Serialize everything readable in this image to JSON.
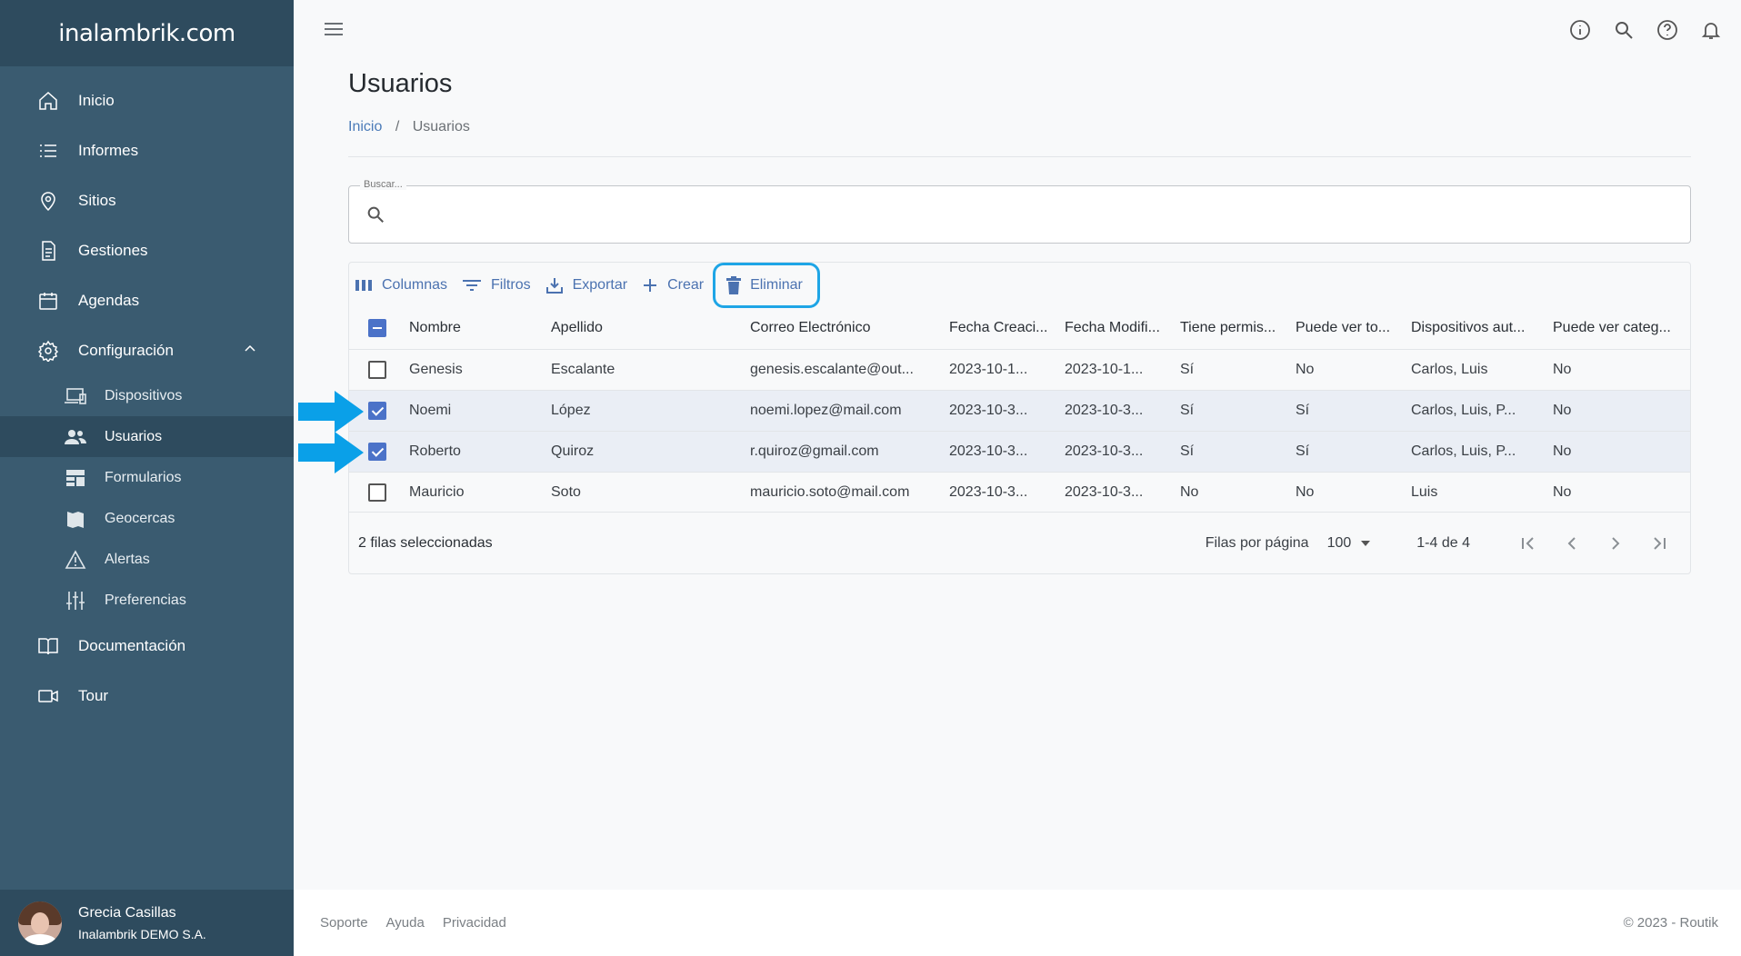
{
  "brand": {
    "logo_text": "inalambrik.com"
  },
  "sidebar": {
    "items": [
      {
        "label": "Inicio",
        "icon": "home-icon"
      },
      {
        "label": "Informes",
        "icon": "list-icon"
      },
      {
        "label": "Sitios",
        "icon": "location-pin-icon"
      },
      {
        "label": "Gestiones",
        "icon": "document-icon"
      },
      {
        "label": "Agendas",
        "icon": "calendar-icon"
      },
      {
        "label": "Configuración",
        "icon": "gear-icon",
        "expanded": true
      }
    ],
    "sub_items": [
      {
        "label": "Dispositivos",
        "icon": "devices-icon"
      },
      {
        "label": "Usuarios",
        "icon": "users-icon",
        "active": true
      },
      {
        "label": "Formularios",
        "icon": "forms-icon"
      },
      {
        "label": "Geocercas",
        "icon": "map-icon"
      },
      {
        "label": "Alertas",
        "icon": "warning-icon"
      },
      {
        "label": "Preferencias",
        "icon": "sliders-icon"
      }
    ],
    "bottom_items": [
      {
        "label": "Documentación",
        "icon": "book-icon"
      },
      {
        "label": "Tour",
        "icon": "video-icon"
      }
    ]
  },
  "user": {
    "name": "Grecia Casillas",
    "org": "Inalambrik DEMO S.A."
  },
  "page": {
    "title": "Usuarios",
    "breadcrumb": {
      "home": "Inicio",
      "separator": "/",
      "current": "Usuarios"
    }
  },
  "search": {
    "label": "Buscar...",
    "value": ""
  },
  "toolbar": {
    "columns": "Columnas",
    "filters": "Filtros",
    "export": "Exportar",
    "create": "Crear",
    "delete": "Eliminar"
  },
  "table": {
    "headers": [
      "Nombre",
      "Apellido",
      "Correo Electrónico",
      "Fecha Creaci...",
      "Fecha Modifi...",
      "Tiene permis...",
      "Puede ver to...",
      "Dispositivos aut...",
      "Puede ver categ..."
    ],
    "rows": [
      {
        "selected": false,
        "cells": [
          "Genesis",
          "Escalante",
          "genesis.escalante@out...",
          "2023-10-1...",
          "2023-10-1...",
          "Sí",
          "No",
          "Carlos, Luis",
          "No"
        ]
      },
      {
        "selected": true,
        "cells": [
          "Noemi",
          "López",
          "noemi.lopez@mail.com",
          "2023-10-3...",
          "2023-10-3...",
          "Sí",
          "Sí",
          "Carlos, Luis, P...",
          "No"
        ]
      },
      {
        "selected": true,
        "cells": [
          "Roberto",
          "Quiroz",
          "r.quiroz@gmail.com",
          "2023-10-3...",
          "2023-10-3...",
          "Sí",
          "Sí",
          "Carlos, Luis, P...",
          "No"
        ]
      },
      {
        "selected": false,
        "cells": [
          "Mauricio",
          "Soto",
          "mauricio.soto@mail.com",
          "2023-10-3...",
          "2023-10-3...",
          "No",
          "No",
          "Luis",
          "No"
        ]
      }
    ]
  },
  "grid_footer": {
    "selected_text": "2 filas seleccionadas",
    "rows_per_page_label": "Filas por página",
    "rows_per_page_value": "100",
    "range": "1-4 de 4"
  },
  "footer": {
    "links": [
      "Soporte",
      "Ayuda",
      "Privacidad"
    ],
    "copyright": "© 2023 - Routik"
  },
  "colors": {
    "sidebar": "#3a5b70",
    "sidebar_dark": "#2e4b5e",
    "accent": "#4b72b0",
    "highlight": "#1ea5e6",
    "arrow": "#0aa0e8"
  }
}
